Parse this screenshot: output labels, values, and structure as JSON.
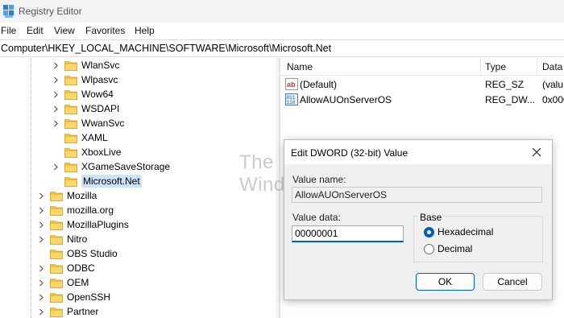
{
  "window": {
    "title": "Registry Editor"
  },
  "menu": [
    "File",
    "Edit",
    "View",
    "Favorites",
    "Help"
  ],
  "address": "Computer\\HKEY_LOCAL_MACHINE\\SOFTWARE\\Microsoft\\Microsoft.Net",
  "tree": {
    "items": [
      {
        "label": "WlanSvc",
        "expandable": true
      },
      {
        "label": "Wlpasvc",
        "expandable": true
      },
      {
        "label": "Wow64",
        "expandable": true
      },
      {
        "label": "WSDAPI",
        "expandable": true
      },
      {
        "label": "WwanSvc",
        "expandable": true
      },
      {
        "label": "XAML",
        "expandable": false
      },
      {
        "label": "XboxLive",
        "expandable": false
      },
      {
        "label": "XGameSaveStorage",
        "expandable": true
      },
      {
        "label": "Microsoft.Net",
        "expandable": false,
        "selected": true
      },
      {
        "label": "Mozilla",
        "expandable": true
      },
      {
        "label": "mozilla.org",
        "expandable": true
      },
      {
        "label": "MozillaPlugins",
        "expandable": true
      },
      {
        "label": "Nitro",
        "expandable": true
      },
      {
        "label": "OBS Studio",
        "expandable": false
      },
      {
        "label": "ODBC",
        "expandable": true
      },
      {
        "label": "OEM",
        "expandable": true
      },
      {
        "label": "OpenSSH",
        "expandable": true
      },
      {
        "label": "Partner",
        "expandable": true
      }
    ]
  },
  "list": {
    "headers": {
      "name": "Name",
      "type": "Type",
      "data": "Data"
    },
    "rows": [
      {
        "icon": "string-value-icon",
        "name": "(Default)",
        "type": "REG_SZ",
        "data": "(valu"
      },
      {
        "icon": "binary-value-icon",
        "name": "AllowAUOnServerOS",
        "type": "REG_DW...",
        "data": "0x000"
      }
    ]
  },
  "dialog": {
    "title": "Edit DWORD (32-bit) Value",
    "value_name_label": "Value name:",
    "value_name": "AllowAUOnServerOS",
    "value_data_label": "Value data:",
    "value_data": "00000001",
    "base_label": "Base",
    "hex_label": "Hexadecimal",
    "dec_label": "Decimal",
    "selected_base": "Hexadecimal",
    "ok_label": "OK",
    "cancel_label": "Cancel"
  },
  "watermark": {
    "line1": "The",
    "line2": "WindowsClub"
  },
  "colors": {
    "accent": "#005fb8",
    "folder": "#f8c84a",
    "selection": "#cce4f7"
  }
}
